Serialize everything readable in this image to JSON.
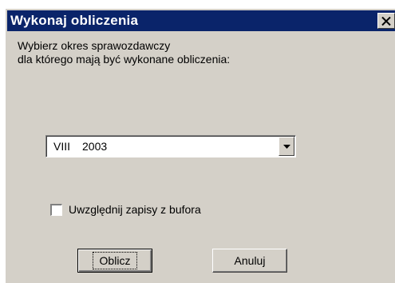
{
  "window": {
    "title": "Wykonaj obliczenia"
  },
  "prompt": {
    "line1": "Wybierz okres sprawozdawczy",
    "line2": "dla którego mają być wykonane obliczenia:"
  },
  "period_select": {
    "month": "VIII",
    "year": "2003"
  },
  "buffer_checkbox": {
    "label": "Uwzględnij zapisy z bufora",
    "checked": false
  },
  "buttons": {
    "calculate_label": "Oblicz",
    "cancel_label": "Anuluj"
  },
  "colors": {
    "titlebar": "#0a246a",
    "face": "#d4d0c8"
  }
}
